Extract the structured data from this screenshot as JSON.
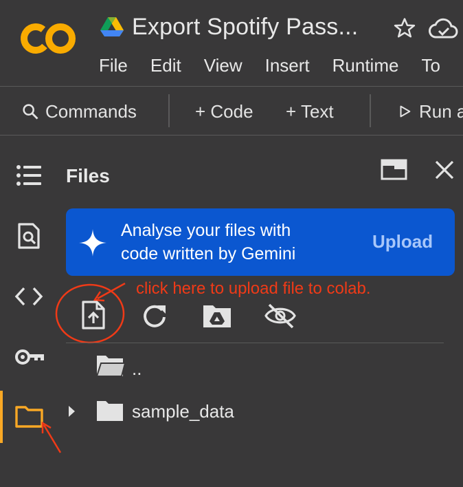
{
  "app": {
    "logo_text": "CO",
    "notebook_title": "Export Spotify Pass...",
    "brand_colors": {
      "logo": "#f9ab00",
      "banner": "#0b57d0",
      "annotation": "#f03a17"
    }
  },
  "menu": [
    "File",
    "Edit",
    "View",
    "Insert",
    "Runtime",
    "To"
  ],
  "toolbar": {
    "commands_label": "Commands",
    "code_label": "+ Code",
    "text_label": "+ Text",
    "run_label": "Run a"
  },
  "files_panel": {
    "title": "Files",
    "banner_text_line1": "Analyse your files with",
    "banner_text_line2": "code written by Gemini",
    "banner_action": "Upload",
    "annotation": "click here to upload file to colab.",
    "tree": {
      "parent": "..",
      "folder": "sample_data"
    }
  },
  "icons": {
    "rail": [
      "toc-icon",
      "find-icon",
      "code-snippets-icon",
      "secrets-key-icon",
      "files-folder-icon"
    ],
    "file_actions": [
      "upload-file-icon",
      "refresh-icon",
      "mount-drive-icon",
      "hide-files-icon"
    ]
  }
}
